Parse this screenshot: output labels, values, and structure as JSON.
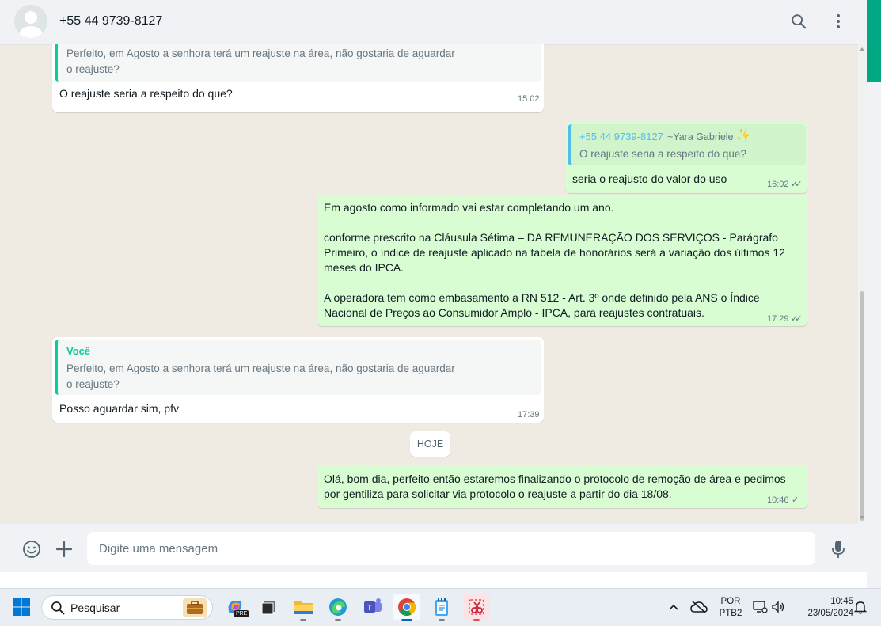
{
  "header": {
    "contact_name": "+55 44 9739-8127",
    "search_icon": "search-icon",
    "menu_icon": "more-vertical-icon"
  },
  "messages": [
    {
      "direction": "in",
      "quote": {
        "text": "Perfeito, em Agosto a senhora terá um reajuste na área, não gostaria de aguardar o reajuste?"
      },
      "text": "O reajuste seria a respeito do que?",
      "time": "15:02"
    },
    {
      "direction": "out",
      "quote": {
        "author": "+55 44 9739-8127",
        "sub": "~Yara Gabriele",
        "text": "O reajuste seria a respeito do que?"
      },
      "text": "seria o reajusto do valor do uso",
      "time": "16:02",
      "status": "read"
    },
    {
      "direction": "out",
      "text": "Em agosto como informado vai estar completando um ano.\n\nconforme prescrito na Cláusula Sétima – DA REMUNERAÇÃO DOS SERVIÇOS - Parágrafo Primeiro, o índice de reajuste aplicado na tabela de honorários será a variação dos últimos 12 meses do IPCA.\n\nA operadora tem como embasamento a RN 512 - Art. 3º onde definido pela ANS o Índice Nacional de Preços ao Consumidor Amplo - IPCA, para reajustes contratuais.",
      "time": "17:29",
      "status": "read"
    },
    {
      "direction": "in",
      "quote": {
        "author": "Você",
        "text": "Perfeito, em Agosto a senhora terá um reajuste na área, não gostaria de aguardar o reajuste?"
      },
      "text": "Posso aguardar sim, pfv",
      "time": "17:39"
    },
    {
      "direction": "out",
      "text": "Olá, bom dia, perfeito então estaremos finalizando o protocolo de remoção de área e pedimos por gentiliza para solicitar via protocolo o reajuste a partir do dia 18/08.",
      "time": "10:46",
      "status": "sent"
    }
  ],
  "date_separator": "HOJE",
  "composer": {
    "placeholder": "Digite uma mensagem",
    "emoji_icon": "emoji-icon",
    "attach_icon": "plus-icon",
    "mic_icon": "microphone-icon"
  },
  "taskbar": {
    "search_label": "Pesquisar",
    "apps": [
      "start-icon",
      "work-briefcase-icon",
      "copilot-icon",
      "task-view-icon",
      "file-explorer-icon",
      "edge-icon",
      "teams-icon",
      "chrome-icon",
      "notepad-icon",
      "snipping-tool-icon"
    ],
    "language": "POR",
    "keyboard": "PTB2",
    "time": "10:45",
    "date": "23/05/2024",
    "pre_badge": "PRE"
  },
  "colors": {
    "chat_bg": "#efeae2",
    "outgoing": "#d9fdd3",
    "incoming": "#ffffff",
    "accent": "#00a884",
    "quote_in": "#06cf9c",
    "quote_out": "#53bdeb"
  }
}
